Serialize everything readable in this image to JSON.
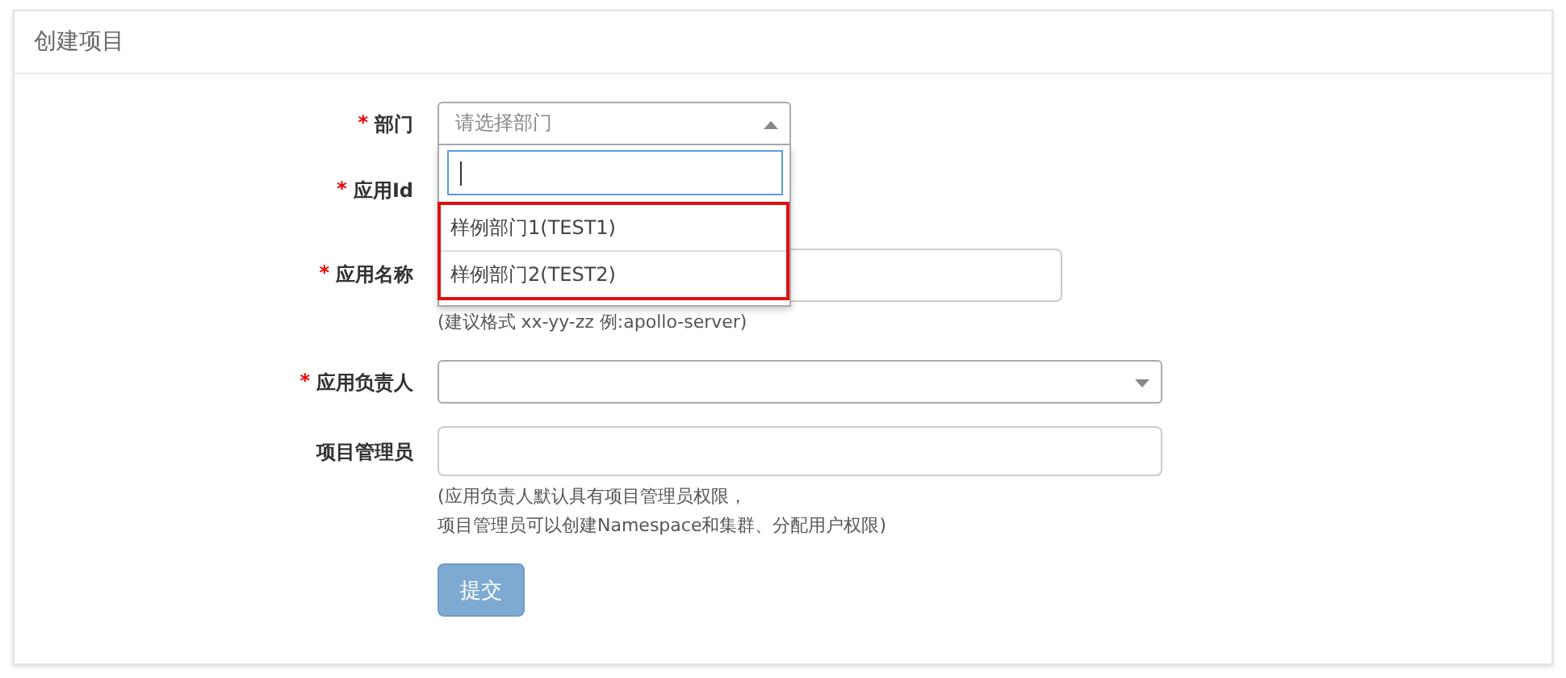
{
  "panel": {
    "title": "创建项目"
  },
  "fields": [
    {
      "label": "部门",
      "required_mark": "*",
      "kind": "select",
      "placeholder": "请选择部门",
      "expanded": true,
      "options": [
        {
          "label": "样例部门1(TEST1)",
          "selected": false
        },
        {
          "label": "样例部门2(TEST2)",
          "selected": false
        }
      ]
    },
    {
      "label": "应用Id",
      "required_mark": "*",
      "kind": "covered"
    },
    {
      "label": "应用名称",
      "required_mark": "*",
      "kind": "input",
      "hint": [
        "(建议格式 xx-yy-zz 例:apollo-server)"
      ]
    },
    {
      "label": "应用负责人",
      "required_mark": "*",
      "kind": "select",
      "expanded": false
    },
    {
      "label": "项目管理员",
      "kind": "input",
      "hint": [
        "(应用负责人默认具有项目管理员权限，",
        "项目管理员可以创建Namespace和集群、分配用户权限)"
      ]
    }
  ],
  "submit": "提交"
}
